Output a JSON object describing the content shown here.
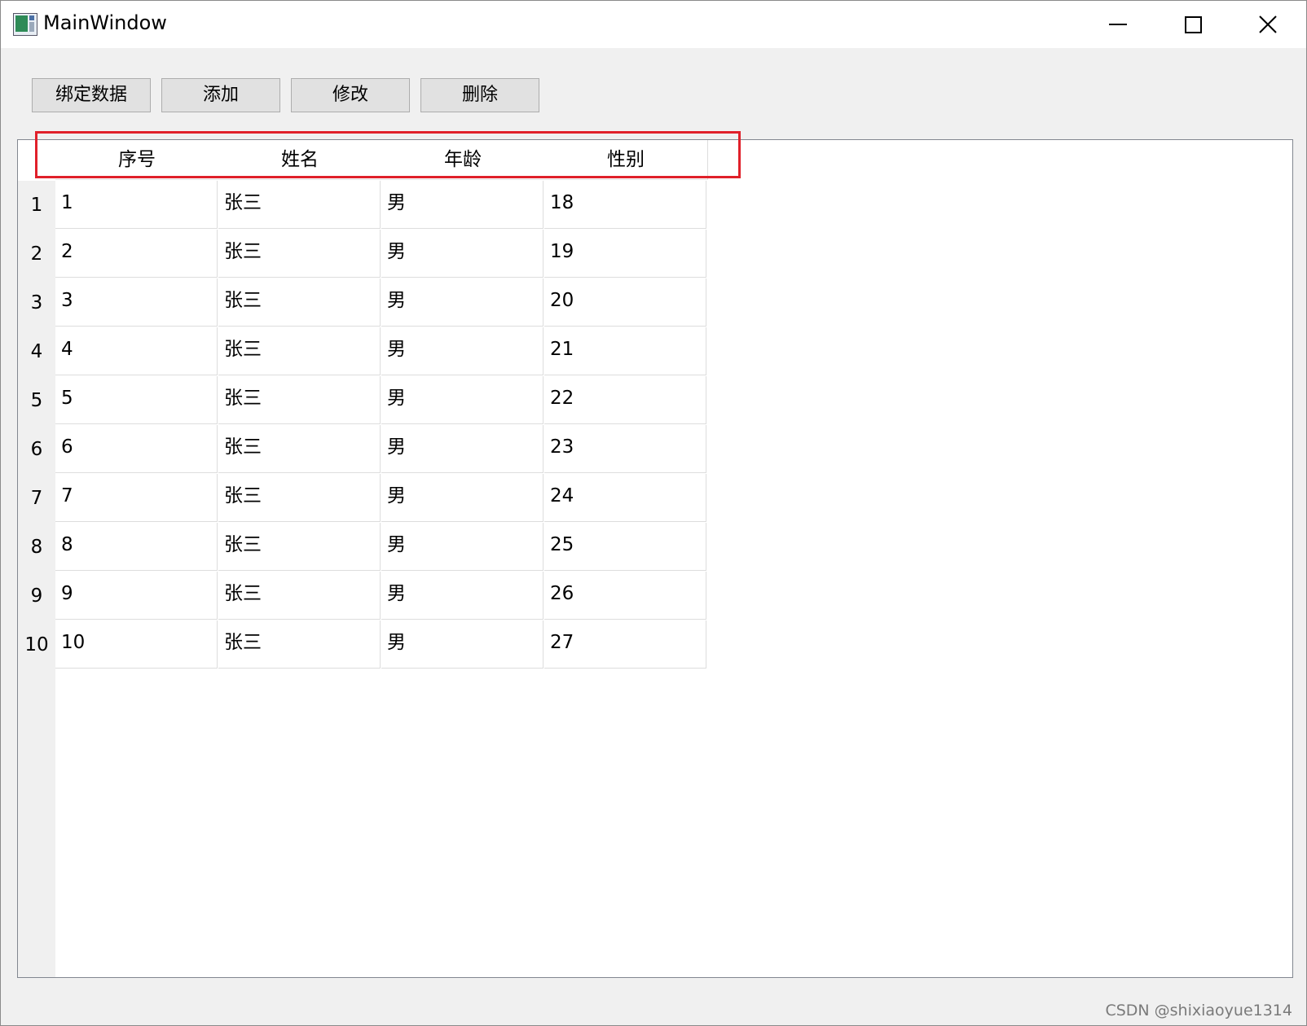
{
  "window": {
    "title": "MainWindow"
  },
  "toolbar": {
    "buttons": [
      {
        "label": "绑定数据"
      },
      {
        "label": "添加"
      },
      {
        "label": "修改"
      },
      {
        "label": "删除"
      }
    ]
  },
  "grid": {
    "columns": [
      "序号",
      "姓名",
      "年龄",
      "性别"
    ],
    "row_numbers": [
      "1",
      "2",
      "3",
      "4",
      "5",
      "6",
      "7",
      "8",
      "9",
      "10"
    ],
    "rows": [
      [
        "1",
        "张三",
        "男",
        "18"
      ],
      [
        "2",
        "张三",
        "男",
        "19"
      ],
      [
        "3",
        "张三",
        "男",
        "20"
      ],
      [
        "4",
        "张三",
        "男",
        "21"
      ],
      [
        "5",
        "张三",
        "男",
        "22"
      ],
      [
        "6",
        "张三",
        "男",
        "23"
      ],
      [
        "7",
        "张三",
        "男",
        "24"
      ],
      [
        "8",
        "张三",
        "男",
        "25"
      ],
      [
        "9",
        "张三",
        "男",
        "26"
      ],
      [
        "10",
        "张三",
        "男",
        "27"
      ]
    ]
  },
  "watermark": "CSDN @shixiaoyue1314",
  "colors": {
    "highlight": "#e0202a",
    "window_bg": "#f0f0f0",
    "button_bg": "#e1e1e1"
  }
}
